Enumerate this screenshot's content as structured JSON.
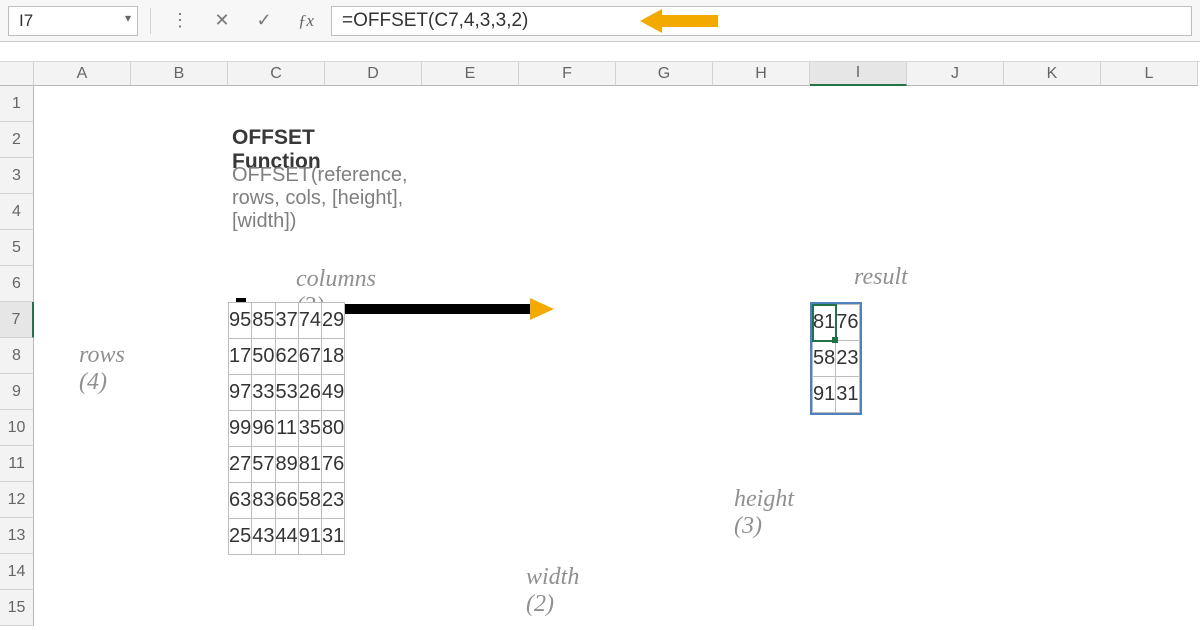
{
  "name_box": "I7",
  "formula": "=OFFSET(C7,4,3,3,2)",
  "columns": [
    "A",
    "B",
    "C",
    "D",
    "E",
    "F",
    "G",
    "H",
    "I",
    "J",
    "K",
    "L"
  ],
  "row_nums": [
    "1",
    "2",
    "3",
    "4",
    "5",
    "6",
    "7",
    "8",
    "9",
    "10",
    "11",
    "12",
    "13",
    "14",
    "15"
  ],
  "title": "OFFSET Function",
  "syntax": "OFFSET(reference, rows, cols, [height], [width])",
  "labels": {
    "columns": "columns (3)",
    "rows": "rows (4)",
    "height": "height (3)",
    "width": "width (2)",
    "result": "result"
  },
  "source_grid": [
    [
      95,
      85,
      37,
      74,
      29
    ],
    [
      17,
      50,
      62,
      67,
      18
    ],
    [
      97,
      33,
      53,
      26,
      49
    ],
    [
      99,
      96,
      11,
      35,
      80
    ],
    [
      27,
      57,
      89,
      81,
      76
    ],
    [
      63,
      83,
      66,
      58,
      23
    ],
    [
      25,
      43,
      44,
      91,
      31
    ]
  ],
  "result_grid": [
    [
      81,
      76
    ],
    [
      58,
      23
    ],
    [
      91,
      31
    ]
  ],
  "selected_cell": "I7",
  "highlighted_origin": [
    0,
    0
  ],
  "highlighted_range": {
    "r0": 4,
    "c0": 3,
    "r1": 6,
    "c1": 4
  }
}
